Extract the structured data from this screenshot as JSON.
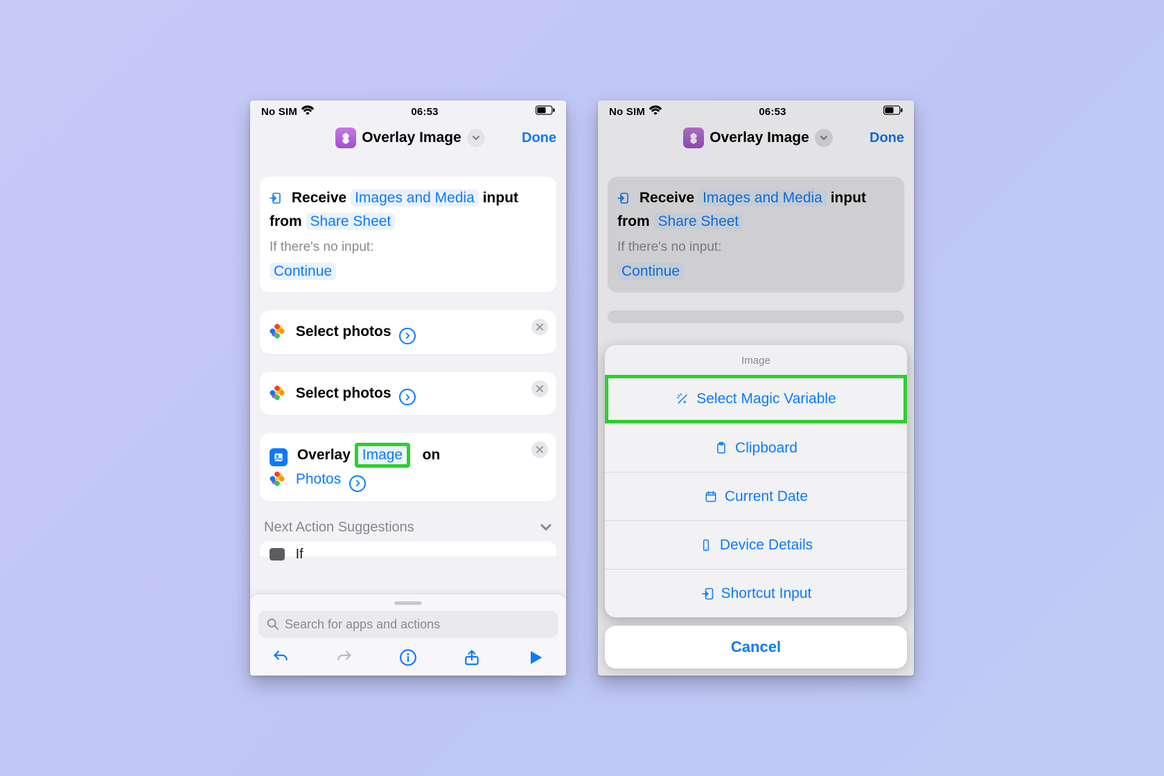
{
  "status": {
    "carrier": "No SIM",
    "time": "06:53"
  },
  "nav": {
    "title": "Overlay Image",
    "done": "Done"
  },
  "receive_card": {
    "word_receive": "Receive",
    "types": "Images and Media",
    "word_from": "input from",
    "source": "Share Sheet",
    "noinput_label": "If there's no input:",
    "fallback": "Continue"
  },
  "select_photos": {
    "label": "Select photos"
  },
  "overlay_card": {
    "word_overlay": "Overlay",
    "token_image": "Image",
    "word_on": "on",
    "token_photos": "Photos"
  },
  "suggestions_label": "Next Action Suggestions",
  "peek_if": "If",
  "search_placeholder": "Search for apps and actions",
  "sheet": {
    "title": "Image",
    "items": {
      "magic": "Select Magic Variable",
      "clipboard": "Clipboard",
      "date": "Current Date",
      "device": "Device Details",
      "shortcut_input": "Shortcut Input"
    },
    "cancel": "Cancel"
  }
}
